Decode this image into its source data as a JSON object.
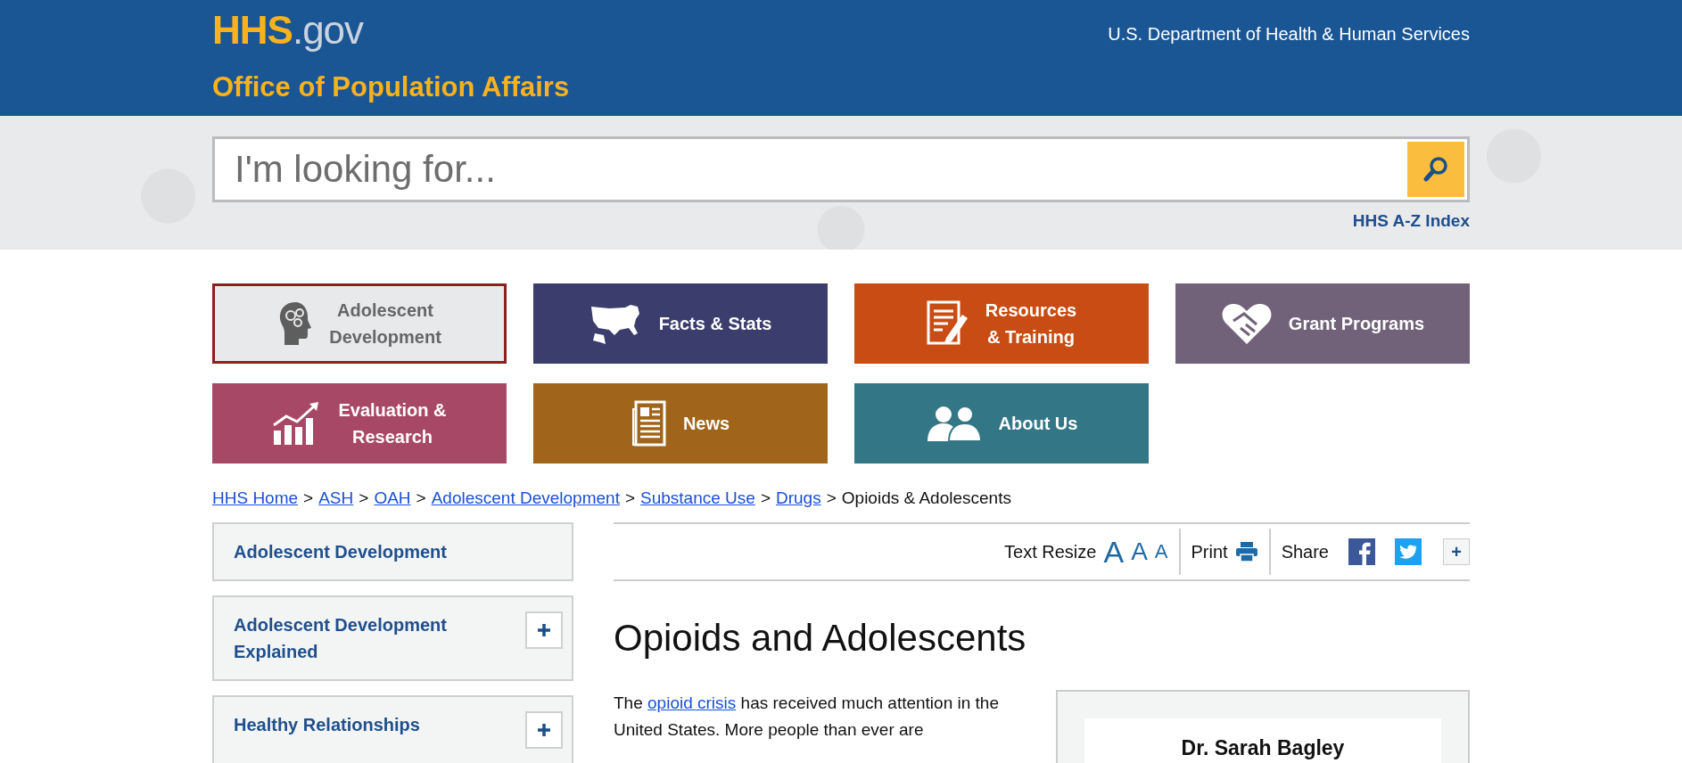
{
  "header": {
    "brand": "HHS",
    "brand_suffix": ".gov",
    "department": "U.S. Department of Health & Human Services",
    "office": "Office of Population Affairs"
  },
  "search": {
    "placeholder": "I'm looking for...",
    "az_link": "HHS A-Z Index"
  },
  "tiles": [
    {
      "label": "Adolescent\nDevelopment",
      "selected": true,
      "color": "#e8e9ea"
    },
    {
      "label": "Facts & Stats",
      "selected": false,
      "color": "#3b3d6d"
    },
    {
      "label": "Resources\n& Training",
      "selected": false,
      "color": "#c84c13"
    },
    {
      "label": "Grant Programs",
      "selected": false,
      "color": "#716279"
    },
    {
      "label": "Evaluation &\nResearch",
      "selected": false,
      "color": "#a84867"
    },
    {
      "label": "News",
      "selected": false,
      "color": "#a0651a"
    },
    {
      "label": "About Us",
      "selected": false,
      "color": "#337787"
    }
  ],
  "breadcrumb": [
    {
      "label": "HHS Home",
      "link": true
    },
    {
      "label": "ASH",
      "link": true
    },
    {
      "label": "OAH",
      "link": true
    },
    {
      "label": "Adolescent Development",
      "link": true
    },
    {
      "label": "Substance Use",
      "link": true
    },
    {
      "label": "Drugs",
      "link": true
    },
    {
      "label": "Opioids & Adolescents",
      "link": false
    }
  ],
  "breadcrumb_separator": ">",
  "sidebar": [
    {
      "label": "Adolescent Development",
      "expandable": false
    },
    {
      "label": "Adolescent Development Explained",
      "expandable": true
    },
    {
      "label": "Healthy Relationships",
      "expandable": true
    }
  ],
  "toolbar": {
    "text_resize": "Text Resize",
    "sizes": [
      "A",
      "A",
      "A"
    ],
    "print": "Print",
    "share": "Share",
    "more": "+"
  },
  "article": {
    "title": "Opioids and Adolescents",
    "paragraph": [
      {
        "text": "The ",
        "link": false
      },
      {
        "text": "opioid crisis",
        "link": true
      },
      {
        "text": " has received much attention in the United States. More people than ever are",
        "link": false
      }
    ]
  },
  "card": {
    "name": "Dr. Sarah Bagley"
  }
}
